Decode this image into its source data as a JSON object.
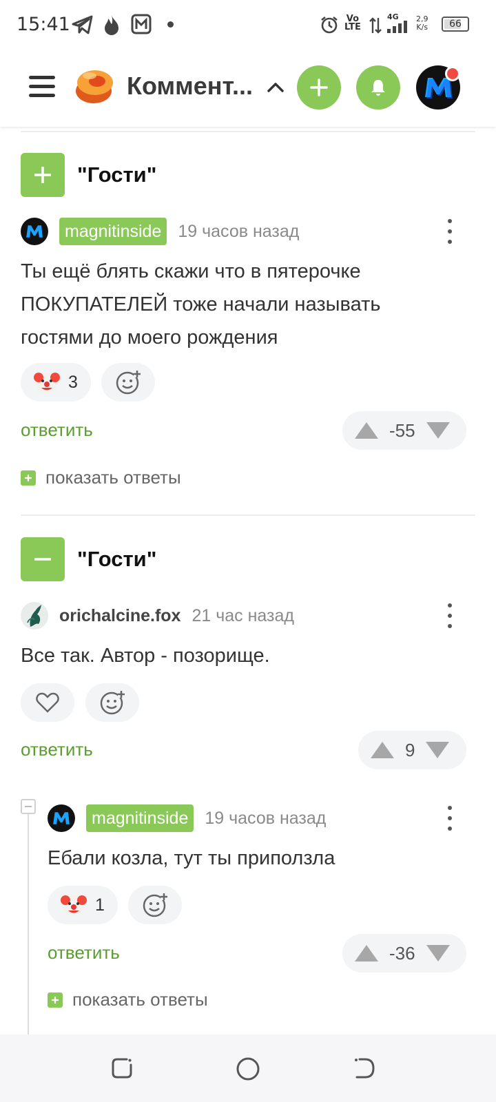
{
  "status_bar": {
    "time": "15:41",
    "network_top": "Vo",
    "network_bottom": "LTE",
    "signal_label": "4G",
    "speed_value": "2,9",
    "speed_unit": "K/s",
    "battery": "66"
  },
  "header": {
    "title": "Коммент..."
  },
  "threads": [
    {
      "title": "\"Гости\"",
      "comments": [
        {
          "author": "magnitinside",
          "time": "19 часов назад",
          "text_lines": [
            "Ты ещё блять скажи что в пятерочке",
            "ПОКУПАТЕЛЕЙ тоже начали называть",
            "гостями до моего рождения"
          ],
          "reaction_count": "3",
          "reply_label": "ответить",
          "score": "-55",
          "show_replies": "показать ответы"
        }
      ]
    },
    {
      "title": "\"Гости\"",
      "comments": [
        {
          "author": "orichalcine.fox",
          "time": "21 час назад",
          "text": "Все так. Автор - позорище.",
          "reply_label": "ответить",
          "score": "9"
        },
        {
          "author": "magnitinside",
          "time": "19 часов назад",
          "text": "Ебали козла, тут ты приползла",
          "reaction_count": "1",
          "reply_label": "ответить",
          "score": "-36",
          "show_replies": "показать ответы"
        }
      ]
    }
  ],
  "colors": {
    "accent_green": "#8ac858",
    "link_green": "#5a9e2f",
    "notification_red": "#ef4b43"
  }
}
